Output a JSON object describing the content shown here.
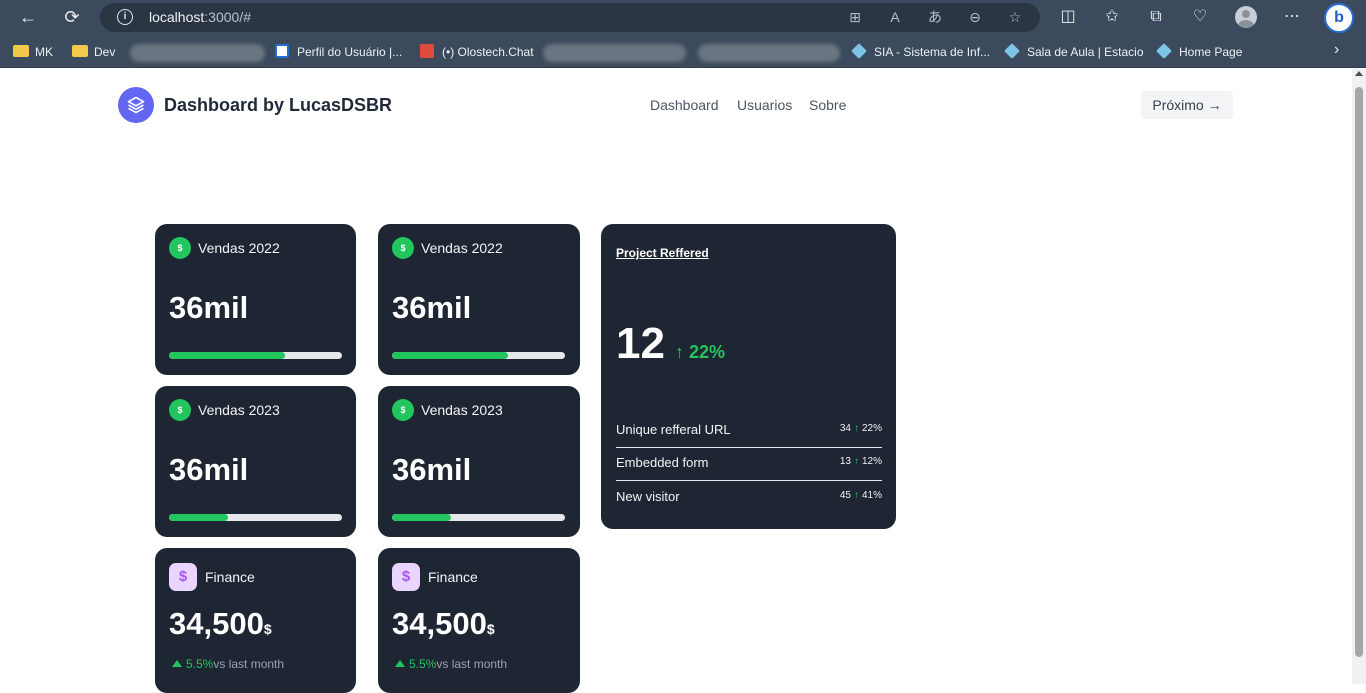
{
  "browser": {
    "url_host": "localhost",
    "url_rest": ":3000/#",
    "bookmarks": [
      {
        "label": "MK",
        "kind": "folder"
      },
      {
        "label": "Dev",
        "kind": "folder"
      },
      {
        "label": "Perfil do Usuário |...",
        "kind": "page"
      },
      {
        "label": "(•) Olostech.Chat",
        "kind": "page"
      },
      {
        "label": "SIA - Sistema de Inf...",
        "kind": "page"
      },
      {
        "label": "Sala de Aula | Estacio",
        "kind": "page"
      },
      {
        "label": "Home Page",
        "kind": "page"
      }
    ]
  },
  "header": {
    "brand": "Dashboard by LucasDSBR",
    "nav": [
      "Dashboard",
      "Usuarios",
      "Sobre"
    ],
    "next_button": "Próximo →"
  },
  "sales_cards": [
    {
      "title": "Vendas 2022",
      "value": "36mil",
      "progress": 0.67
    },
    {
      "title": "Vendas 2022",
      "value": "36mil",
      "progress": 0.67
    },
    {
      "title": "Vendas 2023",
      "value": "36mil",
      "progress": 0.34
    },
    {
      "title": "Vendas 2023",
      "value": "36mil",
      "progress": 0.34
    }
  ],
  "finance_cards": [
    {
      "title": "Finance",
      "value": "34,500",
      "currency": "$",
      "change": "5.5%",
      "change_suffix": "vs last month"
    },
    {
      "title": "Finance",
      "value": "34,500",
      "currency": "$",
      "change": "5.5%",
      "change_suffix": "vs last month"
    }
  ],
  "project": {
    "title": "Project Reffered",
    "value": "12",
    "change": "↑ 22%",
    "rows": [
      {
        "label": "Unique refferal URL",
        "count": "34",
        "pct": "22%"
      },
      {
        "label": "Embedded form",
        "count": "13",
        "pct": "12%"
      },
      {
        "label": "New visitor",
        "count": "45",
        "pct": "41%"
      }
    ]
  },
  "icons": {
    "coin": "$",
    "dollar": "$",
    "up_arrow": "↑"
  },
  "colors": {
    "card_bg": "#1f2633",
    "accent_green": "#22c55e",
    "logo_purple": "#6366f1",
    "finance_icon_bg": "#e9d5ff"
  }
}
